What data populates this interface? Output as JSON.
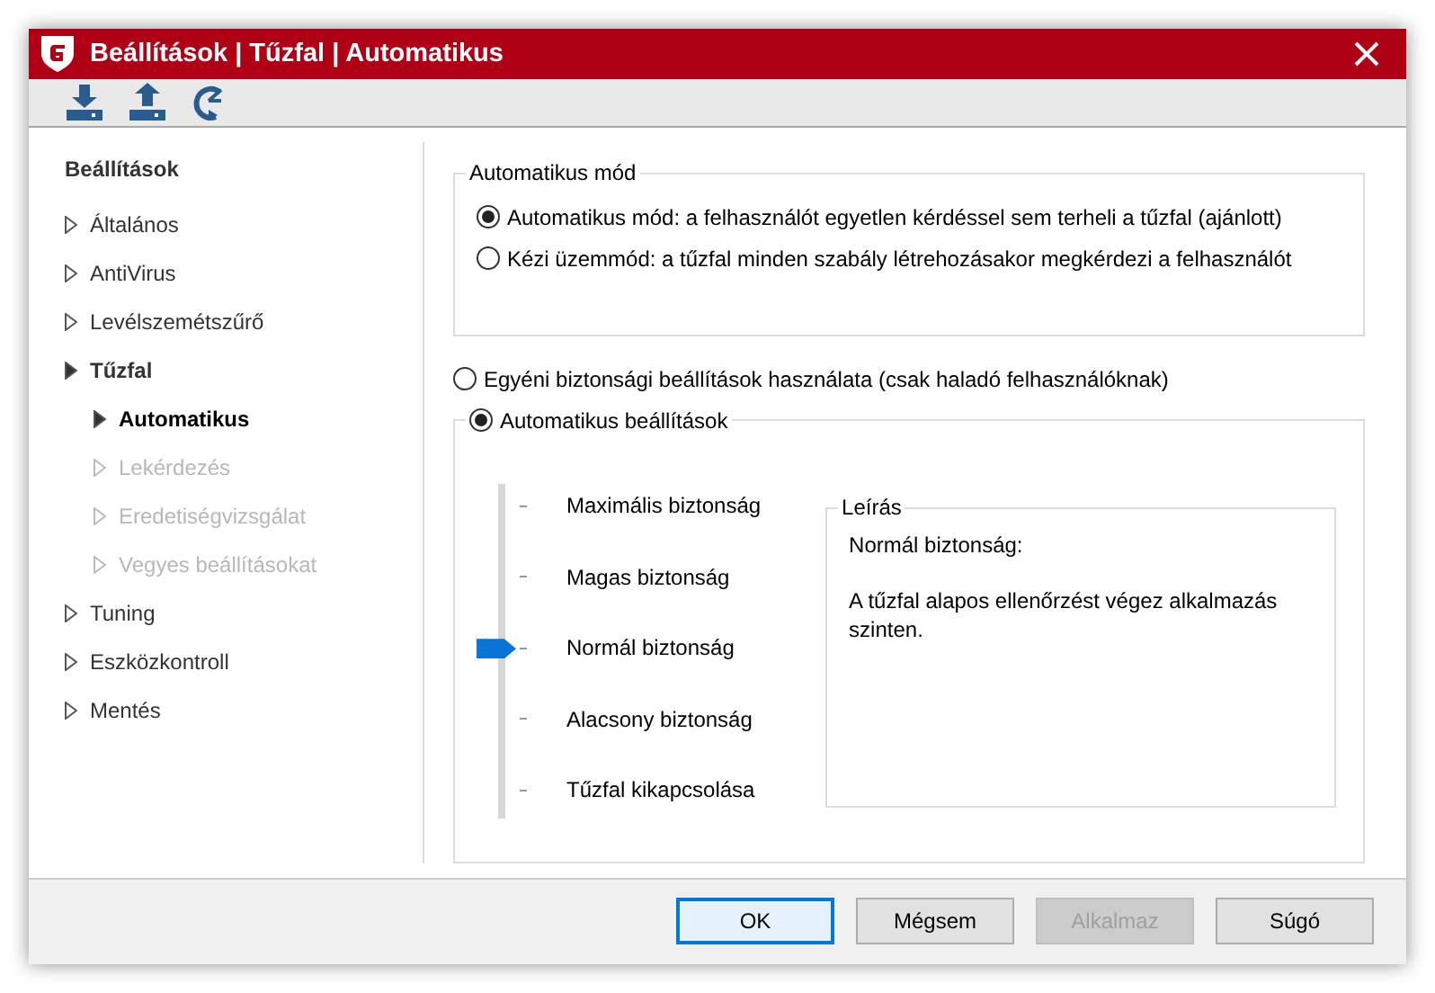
{
  "window": {
    "title": "Beállítások | Tűzfal | Automatikus"
  },
  "sidebar": {
    "heading": "Beállítások",
    "items": [
      {
        "label": "Általános",
        "expanded": false,
        "selected": false,
        "disabled": false
      },
      {
        "label": "AntiVirus",
        "expanded": false,
        "selected": false,
        "disabled": false
      },
      {
        "label": "Levélszemétszűrő",
        "expanded": false,
        "selected": false,
        "disabled": false
      },
      {
        "label": "Tűzfal",
        "expanded": true,
        "selected": false,
        "disabled": false,
        "children": [
          {
            "label": "Automatikus",
            "expanded": false,
            "selected": true,
            "disabled": false
          },
          {
            "label": "Lekérdezés",
            "expanded": false,
            "selected": false,
            "disabled": true
          },
          {
            "label": "Eredetiségvizsgálat",
            "expanded": false,
            "selected": false,
            "disabled": true
          },
          {
            "label": "Vegyes beállításokat",
            "expanded": false,
            "selected": false,
            "disabled": true
          }
        ]
      },
      {
        "label": "Tuning",
        "expanded": false,
        "selected": false,
        "disabled": false
      },
      {
        "label": "Eszközkontroll",
        "expanded": false,
        "selected": false,
        "disabled": false
      },
      {
        "label": "Mentés",
        "expanded": false,
        "selected": false,
        "disabled": false
      }
    ]
  },
  "mode_group": {
    "title": "Automatikus mód",
    "options": [
      {
        "label": "Automatikus mód: a felhasználót egyetlen kérdéssel sem terheli a tűzfal (ajánlott)",
        "selected": true
      },
      {
        "label": "Kézi üzemmód: a tűzfal minden szabály létrehozásakor megkérdezi a felhasználót",
        "selected": false
      }
    ]
  },
  "security_options": [
    {
      "label": "Egyéni biztonsági beállítások használata (csak haladó felhasználóknak)",
      "selected": false
    },
    {
      "label": "Automatikus beállítások",
      "selected": true
    }
  ],
  "levels": [
    {
      "label": "Maximális biztonság",
      "selected": false
    },
    {
      "label": "Magas biztonság",
      "selected": false
    },
    {
      "label": "Normál biztonság",
      "selected": true
    },
    {
      "label": "Alacsony biztonság",
      "selected": false
    },
    {
      "label": "Tűzfal kikapcsolása",
      "selected": false
    }
  ],
  "description": {
    "title": "Leírás",
    "heading": "Normál biztonság:",
    "text": "A tűzfal alapos ellenőrzést végez alkalmazás szinten."
  },
  "buttons": [
    {
      "label": "OK",
      "default": true,
      "disabled": false
    },
    {
      "label": "Mégsem",
      "default": false,
      "disabled": false
    },
    {
      "label": "Alkalmaz",
      "default": false,
      "disabled": true
    },
    {
      "label": "Súgó",
      "default": false,
      "disabled": false
    }
  ]
}
